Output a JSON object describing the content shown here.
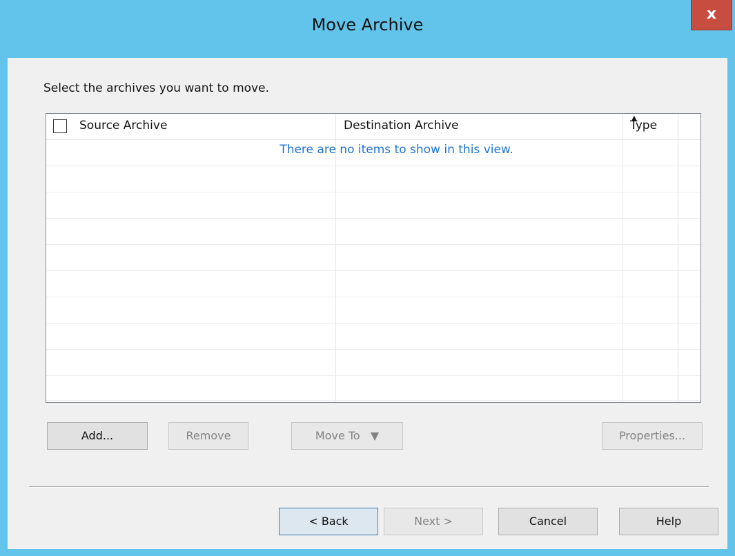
{
  "window": {
    "title": "Move Archive",
    "close_label": "x"
  },
  "instruction": "Select the archives you want to move.",
  "list": {
    "columns": [
      "Source Archive",
      "Destination Archive",
      "Type"
    ],
    "empty_message": "There are no items to show in this view."
  },
  "action_buttons": {
    "add": "Add...",
    "remove": "Remove",
    "move_to": "Move To",
    "move_to_arrow": "▼",
    "properties": "Properties..."
  },
  "footer_buttons": {
    "back": "< Back",
    "next": "Next >",
    "cancel": "Cancel",
    "help": "Help"
  },
  "icons": {
    "sort": "sort-ascending-icon"
  },
  "colors": {
    "titlebar": "#62c4ea",
    "close": "#c74d41",
    "empty_message": "#1e73d2"
  }
}
